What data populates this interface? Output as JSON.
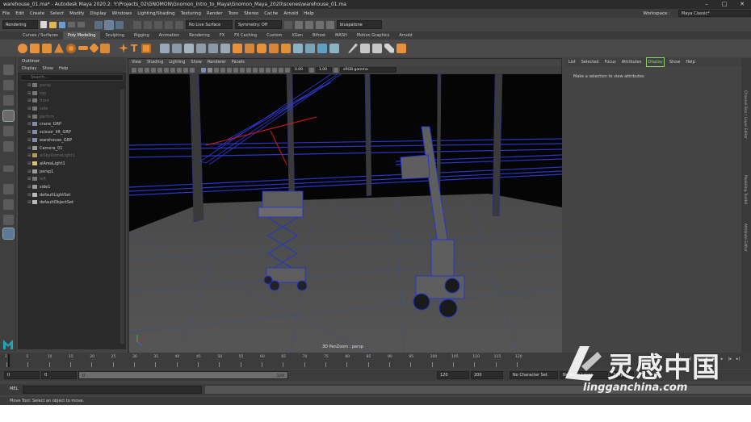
{
  "titlebar": {
    "title": "warehouse_01.ma* - Autodesk Maya 2020.2: Y:\\Projects_02\\GNOMON\\Gnomon_Intro_to_Maya\\Gnomon_Maya_2020\\scenes\\warehouse_01.ma",
    "minimize": "–",
    "maximize": "□",
    "close": "✕"
  },
  "menubar": {
    "items": [
      "File",
      "Edit",
      "Create",
      "Select",
      "Modify",
      "Display",
      "Windows",
      "Lighting/Shading",
      "Texturing",
      "Render",
      "Toon",
      "Stereo",
      "Cache",
      "Arnold",
      "Help"
    ],
    "workspace_label": "Workspace :",
    "workspace_value": "Maya Classic*"
  },
  "statusline": {
    "menuset": "Rendering",
    "live_surface": "No Live Surface",
    "symmetry": "Symmetry: Off",
    "renderer": "bluspatone"
  },
  "shelf": {
    "tabs": [
      "Curves / Surfaces",
      "Poly Modeling",
      "Sculpting",
      "Rigging",
      "Animation",
      "Rendering",
      "FX",
      "FX Caching",
      "Custom",
      "XGen",
      "Bifrost",
      "MASH",
      "Motion Graphics",
      "Arnold"
    ],
    "active_tab": "Poly Modeling"
  },
  "outliner": {
    "title": "Outliner",
    "menu": [
      "Display",
      "Show",
      "Help"
    ],
    "search_placeholder": "Search...",
    "items": [
      {
        "label": "persp",
        "dim": true,
        "color": "#777777"
      },
      {
        "label": "top",
        "dim": true,
        "color": "#777777"
      },
      {
        "label": "front",
        "dim": true,
        "color": "#777777"
      },
      {
        "label": "side",
        "dim": true,
        "color": "#777777"
      },
      {
        "label": "perfcm",
        "dim": true,
        "color": "#777777"
      },
      {
        "label": "crane_GRP",
        "dim": false,
        "color": "#7f8fa8"
      },
      {
        "label": "scissor_lift_GRP",
        "dim": false,
        "color": "#7f8fa8"
      },
      {
        "label": "warehouse_GRP",
        "dim": false,
        "color": "#7f8fa8"
      },
      {
        "label": "Camera_01",
        "dim": false,
        "color": "#9a9a9a"
      },
      {
        "label": "aiSkyDomeLight1",
        "dim": true,
        "color": "#b59d55"
      },
      {
        "label": "aiAreaLight1",
        "dim": false,
        "color": "#d8c271"
      },
      {
        "label": "persp1",
        "dim": false,
        "color": "#9a9a9a"
      },
      {
        "label": "left",
        "dim": true,
        "color": "#777777"
      },
      {
        "label": "side1",
        "dim": false,
        "color": "#9a9a9a"
      },
      {
        "label": "defaultLightSet",
        "dim": false,
        "color": "#b8b8b8"
      },
      {
        "label": "defaultObjectSet",
        "dim": false,
        "color": "#b8b8b8"
      }
    ]
  },
  "viewport": {
    "menu": [
      "View",
      "Shading",
      "Lighting",
      "Show",
      "Renderer",
      "Panels"
    ],
    "exposure": "0.00",
    "gamma": "1.00",
    "color_space": "sRGB gamma",
    "camera_label": "3D PanZoom : persp"
  },
  "attribute_editor": {
    "menu": [
      "List",
      "Selected",
      "Focus",
      "Attributes",
      "Display",
      "Show",
      "Help"
    ],
    "highlighted": "Display",
    "message": "Make a selection to view attributes"
  },
  "side_tabs": [
    "Channel Box / Layer Editor",
    "Modeling Toolkit",
    "Attribute Editor"
  ],
  "timeslider": {
    "labels": [
      "1",
      "5",
      "10",
      "15",
      "20",
      "25",
      "30",
      "35",
      "40",
      "45",
      "50",
      "55",
      "60",
      "65",
      "70",
      "75",
      "80",
      "85",
      "90",
      "95",
      "100",
      "105",
      "110",
      "115",
      "120"
    ],
    "current_frame": "1"
  },
  "range": {
    "start": "0",
    "anim_start": "0",
    "slider_start": "0",
    "slider_end": "120",
    "anim_end": "120",
    "end": "200",
    "character_set": "No Character Set",
    "anim_layer": "No Anim Layer",
    "fps": "24 fps"
  },
  "cmdline": {
    "language": "MEL"
  },
  "helpline": {
    "text": "Move Tool: Select an object to move."
  },
  "watermark": {
    "chinese": "灵感中国",
    "url": "lingganchina.com"
  },
  "colors": {
    "wire_blue": "#1f2bd0",
    "accent_red": "#d21818",
    "grid": "#3d4f7a",
    "shelf_orange": "#e8913a"
  }
}
